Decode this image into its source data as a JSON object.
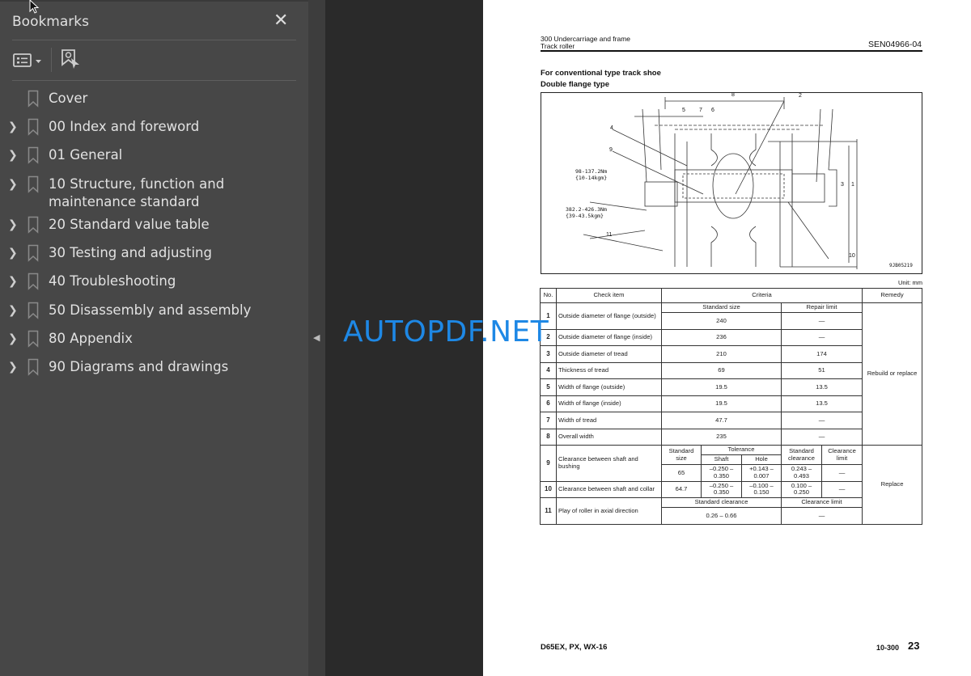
{
  "sidebar": {
    "title": "Bookmarks",
    "close_icon": "close-icon",
    "items": [
      {
        "label": "Cover",
        "expandable": false
      },
      {
        "label": "00 Index and foreword",
        "expandable": true
      },
      {
        "label": "01 General",
        "expandable": true
      },
      {
        "label": "10 Structure, function and maintenance standard",
        "expandable": true
      },
      {
        "label": "20 Standard value table",
        "expandable": true
      },
      {
        "label": "30 Testing and adjusting",
        "expandable": true
      },
      {
        "label": "40 Troubleshooting",
        "expandable": true
      },
      {
        "label": "50 Disassembly and assembly",
        "expandable": true
      },
      {
        "label": "80 Appendix",
        "expandable": true
      },
      {
        "label": "90 Diagrams and drawings",
        "expandable": true
      }
    ]
  },
  "watermark": "AUTOPDF.NET",
  "page": {
    "section": "300 Undercarriage and frame",
    "subsection": "Track roller",
    "doc_code": "SEN04966-04",
    "heading1": "For conventional type track shoe",
    "heading2": "Double flange type",
    "diagram": {
      "labels": [
        "1",
        "2",
        "3",
        "4",
        "5",
        "6",
        "7",
        "8",
        "9",
        "10",
        "11"
      ],
      "torque1": "98-137.2Nm",
      "torque1b": "{10-14kgm}",
      "torque2": "382.2-426.3Nm",
      "torque2b": "{39-43.5kgm}",
      "figure_id": "9JB05219"
    },
    "unit": "Unit: mm",
    "table": {
      "h_no": "No.",
      "h_item": "Check item",
      "h_criteria": "Criteria",
      "h_remedy": "Remedy",
      "h_std_size": "Standard size",
      "h_repair": "Repair limit",
      "rows": [
        {
          "no": "1",
          "item": "Outside diameter of flange (outside)",
          "std": "240",
          "limit": "—"
        },
        {
          "no": "2",
          "item": "Outside diameter of flange (inside)",
          "std": "236",
          "limit": "—"
        },
        {
          "no": "3",
          "item": "Outside diameter of tread",
          "std": "210",
          "limit": "174"
        },
        {
          "no": "4",
          "item": "Thickness of tread",
          "std": "69",
          "limit": "51"
        },
        {
          "no": "5",
          "item": "Width of flange (outside)",
          "std": "19.5",
          "limit": "13.5"
        },
        {
          "no": "6",
          "item": "Width of flange (inside)",
          "std": "19.5",
          "limit": "13.5"
        },
        {
          "no": "7",
          "item": "Width of tread",
          "std": "47.7",
          "limit": "—"
        },
        {
          "no": "8",
          "item": "Overall width",
          "std": "235",
          "limit": "—"
        }
      ],
      "remedy1": "Rebuild or replace",
      "h_std_size2": "Standard size",
      "h_tolerance": "Tolerance",
      "h_shaft": "Shaft",
      "h_hole": "Hole",
      "h_std_clear": "Standard clearance",
      "h_clear_limit": "Clearance limit",
      "r9": {
        "no": "9",
        "item": "Clearance between shaft and bushing",
        "size": "65",
        "shaft": "–0.250 –0.350",
        "hole": "+0.143 –0.007",
        "clear": "0.243 – 0.493",
        "limit": "—"
      },
      "r10": {
        "no": "10",
        "item": "Clearance between shaft and collar",
        "size": "64.7",
        "shaft": "–0.250 –0.350",
        "hole": "–0.100 –0.150",
        "clear": "0.100 – 0.250",
        "limit": "—"
      },
      "r11": {
        "no": "11",
        "item": "Play of roller in axial direction",
        "h_std": "Standard clearance",
        "h_limit": "Clearance limit",
        "std": "0.26 – 0.66",
        "limit": "—"
      },
      "remedy2": "Replace"
    },
    "footer_model": "D65EX, PX, WX-16",
    "footer_code": "10-300",
    "page_number": "23"
  }
}
